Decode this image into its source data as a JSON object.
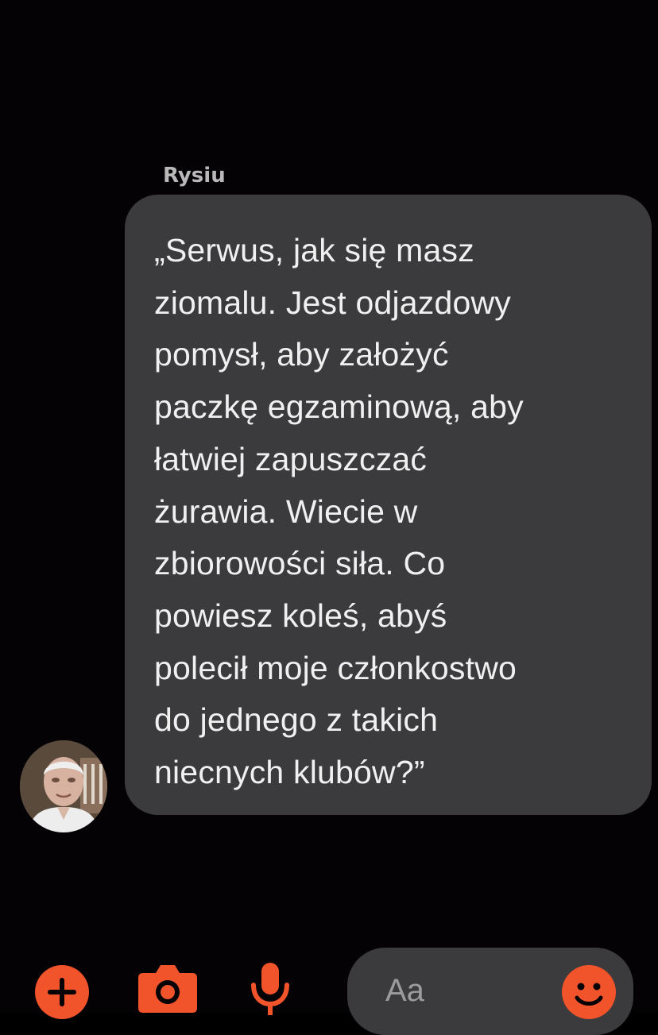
{
  "conversation": {
    "sender_name": "Rysiu",
    "message_lines": [
      "„Serwus, jak się masz",
      "ziomalu. Jest odjazdowy",
      "pomysł, aby założyć",
      "paczkę egzaminową, aby",
      "łatwiej zapuszczać",
      "żurawia. Wiecie w",
      "zbiorowości siła. Co",
      "powiesz koleś, abyś",
      "polecił moje członkostwo",
      "do jednego z takich",
      "niecnych klubów?”"
    ]
  },
  "composer": {
    "placeholder": "Aa",
    "icons": [
      "plus-icon",
      "camera-icon",
      "microphone-icon",
      "smiley-icon"
    ]
  },
  "colors": {
    "background": "#040204",
    "bubble": "#3b3a3c",
    "text": "#f0f0f0",
    "sender_name": "#b9b9b9",
    "accent": "#f1532a"
  }
}
